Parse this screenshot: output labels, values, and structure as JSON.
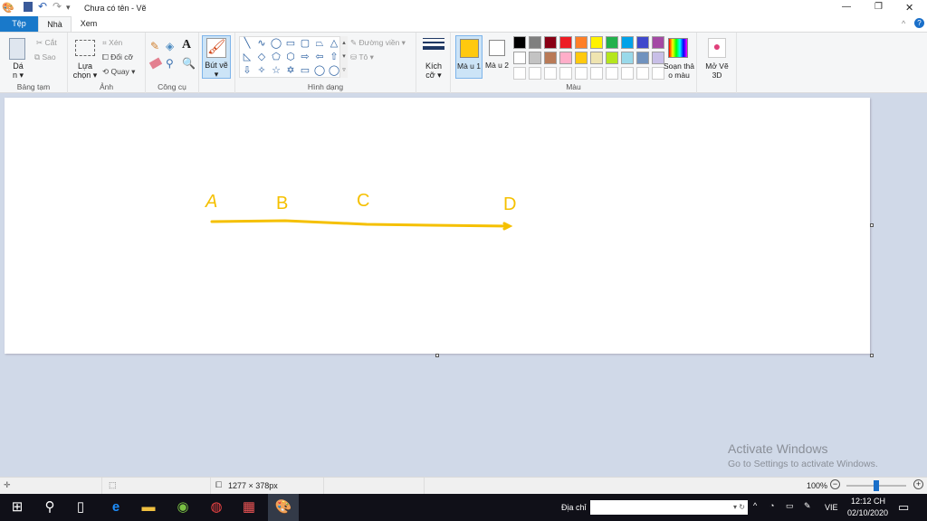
{
  "window": {
    "title": "Chưa có tên - Vẽ",
    "minimize": "—",
    "maximize": "❐",
    "close": "✕",
    "help": "?"
  },
  "tabs": [
    {
      "label": "Tệp"
    },
    {
      "label": "Nhà"
    },
    {
      "label": "Xem"
    }
  ],
  "ribbon": {
    "clipboard": {
      "paste": "Dá\nn ▾",
      "cut": "Cắt",
      "copy": "Sao",
      "label": "Bảng tạm"
    },
    "image": {
      "select": "Lựa chọn ▾",
      "crop": "Xén",
      "resize": "Đổi cỡ",
      "rotate": "Quay ▾",
      "label": "Ảnh"
    },
    "tools": {
      "label": "Công cụ"
    },
    "brush": {
      "label": "Bút vẽ ▾"
    },
    "shapes": {
      "outline": "Đường viền ▾",
      "fill": "Tô ▾",
      "label": "Hình dạng",
      "glyphs": [
        "╲",
        "∿",
        "◯",
        "▭",
        "▢",
        "⏢",
        "△",
        "◺",
        "◇",
        "⬠",
        "⬡",
        "⇨",
        "⇦",
        "⇧",
        "⇩",
        "✧",
        "☆",
        "✡",
        "▭",
        "◯",
        "◯"
      ]
    },
    "size": {
      "label": "Kích cỡ ▾"
    },
    "colors": {
      "color1": "Mà u 1",
      "color2": "Mà u 2",
      "edit": "Soạn thả o màu",
      "label": "Màu",
      "color1_value": "#ffc90e",
      "color2_value": "#ffffff",
      "palette": [
        "#000000",
        "#7f7f7f",
        "#880015",
        "#ed1c24",
        "#ff7f27",
        "#fff200",
        "#22b14c",
        "#00a2e8",
        "#3f48cc",
        "#a349a4",
        "#ffffff",
        "#c3c3c3",
        "#b97a57",
        "#ffaec9",
        "#ffc90e",
        "#efe4b0",
        "#b5e61d",
        "#99d9ea",
        "#7092be",
        "#c8bfe7"
      ]
    },
    "paint3d": {
      "label": "Mở Vẽ 3D"
    }
  },
  "drawing": {
    "labels": [
      "A",
      "B",
      "C",
      "D"
    ],
    "stroke_color": "#f5c000"
  },
  "status": {
    "dimensions": "1277 × 378px",
    "zoom": "100%",
    "zoom_fraction": 0.5
  },
  "watermark": {
    "title": "Activate Windows",
    "sub": "Go to Settings to activate Windows."
  },
  "taskbar": {
    "address_label": "Địa chỉ",
    "address_value": "",
    "lang": "VIE",
    "time": "12:12 CH",
    "date": "02/10/2020"
  }
}
